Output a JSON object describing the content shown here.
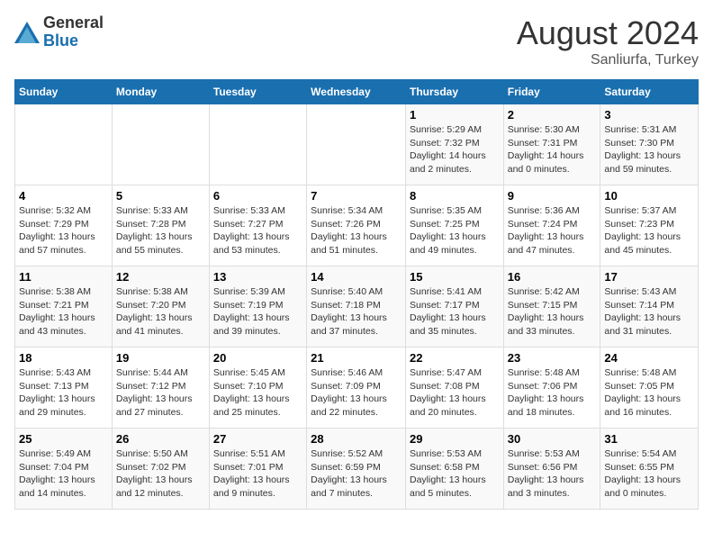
{
  "header": {
    "logo_general": "General",
    "logo_blue": "Blue",
    "month_title": "August 2024",
    "location": "Sanliurfa, Turkey"
  },
  "days_of_week": [
    "Sunday",
    "Monday",
    "Tuesday",
    "Wednesday",
    "Thursday",
    "Friday",
    "Saturday"
  ],
  "weeks": [
    [
      {
        "day": "",
        "info": ""
      },
      {
        "day": "",
        "info": ""
      },
      {
        "day": "",
        "info": ""
      },
      {
        "day": "",
        "info": ""
      },
      {
        "day": "1",
        "info": "Sunrise: 5:29 AM\nSunset: 7:32 PM\nDaylight: 14 hours\nand 2 minutes."
      },
      {
        "day": "2",
        "info": "Sunrise: 5:30 AM\nSunset: 7:31 PM\nDaylight: 14 hours\nand 0 minutes."
      },
      {
        "day": "3",
        "info": "Sunrise: 5:31 AM\nSunset: 7:30 PM\nDaylight: 13 hours\nand 59 minutes."
      }
    ],
    [
      {
        "day": "4",
        "info": "Sunrise: 5:32 AM\nSunset: 7:29 PM\nDaylight: 13 hours\nand 57 minutes."
      },
      {
        "day": "5",
        "info": "Sunrise: 5:33 AM\nSunset: 7:28 PM\nDaylight: 13 hours\nand 55 minutes."
      },
      {
        "day": "6",
        "info": "Sunrise: 5:33 AM\nSunset: 7:27 PM\nDaylight: 13 hours\nand 53 minutes."
      },
      {
        "day": "7",
        "info": "Sunrise: 5:34 AM\nSunset: 7:26 PM\nDaylight: 13 hours\nand 51 minutes."
      },
      {
        "day": "8",
        "info": "Sunrise: 5:35 AM\nSunset: 7:25 PM\nDaylight: 13 hours\nand 49 minutes."
      },
      {
        "day": "9",
        "info": "Sunrise: 5:36 AM\nSunset: 7:24 PM\nDaylight: 13 hours\nand 47 minutes."
      },
      {
        "day": "10",
        "info": "Sunrise: 5:37 AM\nSunset: 7:23 PM\nDaylight: 13 hours\nand 45 minutes."
      }
    ],
    [
      {
        "day": "11",
        "info": "Sunrise: 5:38 AM\nSunset: 7:21 PM\nDaylight: 13 hours\nand 43 minutes."
      },
      {
        "day": "12",
        "info": "Sunrise: 5:38 AM\nSunset: 7:20 PM\nDaylight: 13 hours\nand 41 minutes."
      },
      {
        "day": "13",
        "info": "Sunrise: 5:39 AM\nSunset: 7:19 PM\nDaylight: 13 hours\nand 39 minutes."
      },
      {
        "day": "14",
        "info": "Sunrise: 5:40 AM\nSunset: 7:18 PM\nDaylight: 13 hours\nand 37 minutes."
      },
      {
        "day": "15",
        "info": "Sunrise: 5:41 AM\nSunset: 7:17 PM\nDaylight: 13 hours\nand 35 minutes."
      },
      {
        "day": "16",
        "info": "Sunrise: 5:42 AM\nSunset: 7:15 PM\nDaylight: 13 hours\nand 33 minutes."
      },
      {
        "day": "17",
        "info": "Sunrise: 5:43 AM\nSunset: 7:14 PM\nDaylight: 13 hours\nand 31 minutes."
      }
    ],
    [
      {
        "day": "18",
        "info": "Sunrise: 5:43 AM\nSunset: 7:13 PM\nDaylight: 13 hours\nand 29 minutes."
      },
      {
        "day": "19",
        "info": "Sunrise: 5:44 AM\nSunset: 7:12 PM\nDaylight: 13 hours\nand 27 minutes."
      },
      {
        "day": "20",
        "info": "Sunrise: 5:45 AM\nSunset: 7:10 PM\nDaylight: 13 hours\nand 25 minutes."
      },
      {
        "day": "21",
        "info": "Sunrise: 5:46 AM\nSunset: 7:09 PM\nDaylight: 13 hours\nand 22 minutes."
      },
      {
        "day": "22",
        "info": "Sunrise: 5:47 AM\nSunset: 7:08 PM\nDaylight: 13 hours\nand 20 minutes."
      },
      {
        "day": "23",
        "info": "Sunrise: 5:48 AM\nSunset: 7:06 PM\nDaylight: 13 hours\nand 18 minutes."
      },
      {
        "day": "24",
        "info": "Sunrise: 5:48 AM\nSunset: 7:05 PM\nDaylight: 13 hours\nand 16 minutes."
      }
    ],
    [
      {
        "day": "25",
        "info": "Sunrise: 5:49 AM\nSunset: 7:04 PM\nDaylight: 13 hours\nand 14 minutes."
      },
      {
        "day": "26",
        "info": "Sunrise: 5:50 AM\nSunset: 7:02 PM\nDaylight: 13 hours\nand 12 minutes."
      },
      {
        "day": "27",
        "info": "Sunrise: 5:51 AM\nSunset: 7:01 PM\nDaylight: 13 hours\nand 9 minutes."
      },
      {
        "day": "28",
        "info": "Sunrise: 5:52 AM\nSunset: 6:59 PM\nDaylight: 13 hours\nand 7 minutes."
      },
      {
        "day": "29",
        "info": "Sunrise: 5:53 AM\nSunset: 6:58 PM\nDaylight: 13 hours\nand 5 minutes."
      },
      {
        "day": "30",
        "info": "Sunrise: 5:53 AM\nSunset: 6:56 PM\nDaylight: 13 hours\nand 3 minutes."
      },
      {
        "day": "31",
        "info": "Sunrise: 5:54 AM\nSunset: 6:55 PM\nDaylight: 13 hours\nand 0 minutes."
      }
    ]
  ]
}
